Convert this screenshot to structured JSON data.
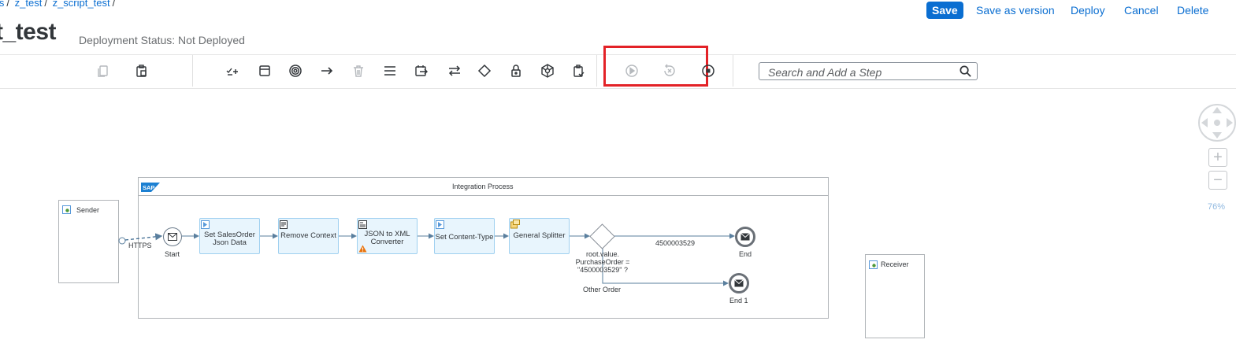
{
  "breadcrumb": {
    "items": [
      {
        "label": "ls"
      },
      {
        "label": "z_test"
      },
      {
        "label": "z_script_test"
      }
    ]
  },
  "header": {
    "title": "t_test",
    "deployment_status": "Deployment Status: Not Deployed",
    "buttons": {
      "save": "Save",
      "save_as_version": "Save as version",
      "deploy": "Deploy",
      "cancel": "Cancel",
      "delete": "Delete"
    },
    "accent_color": "#0a6ed1"
  },
  "toolbar": {
    "search_placeholder": "Search and Add a Step",
    "icons": [
      "copy-icon",
      "paste-icon",
      "participants-icon",
      "process-icon",
      "events-icon",
      "connector-icon",
      "delete-icon",
      "menu-icon",
      "call-icon",
      "mapping-icon",
      "transformation-icon",
      "routing-icon",
      "security-icon",
      "persistence-icon",
      "validator-icon",
      "simulation-start-icon",
      "clear-simulation-icon",
      "stop-simulation-icon",
      "search-icon"
    ],
    "highlight_color": "#e32227"
  },
  "canvas": {
    "pool_title": "Integration Process",
    "sap_logo": "SAP",
    "sender": "Sender",
    "receiver": "Receiver",
    "https_label": "HTTPS",
    "start_label": "Start",
    "steps": [
      {
        "label": "Set SalesOrder Json Data"
      },
      {
        "label": "Remove Context"
      },
      {
        "label": "JSON to XML Converter"
      },
      {
        "label": "Set Content-Type"
      },
      {
        "label": "General Splitter"
      }
    ],
    "gateway_label": "root.value. PurchaseOrder = \"4500003529\" ?",
    "route_1_label": "4500003529",
    "route_2_label": "Other Order",
    "end_label": "End",
    "end_1_label": "End 1"
  },
  "zoom": {
    "level": "76%",
    "in": "+",
    "out": "−"
  }
}
